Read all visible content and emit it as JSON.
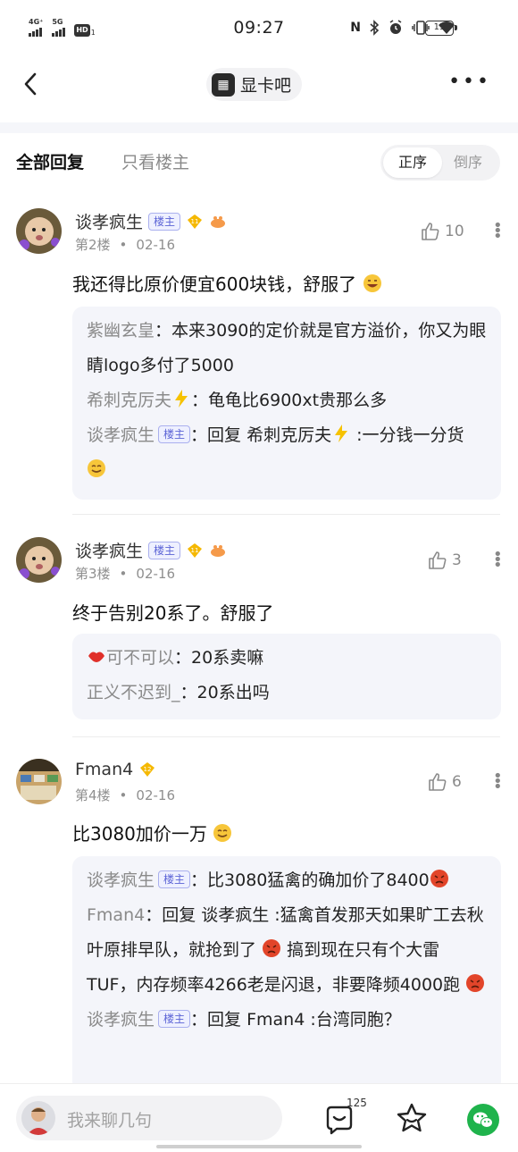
{
  "status_bar": {
    "time": "09:27",
    "sig1": "4G⁺",
    "sig2": "5G",
    "hd": "HD",
    "hd_sub": "1",
    "battery": "15"
  },
  "nav": {
    "forum_name": "显卡吧"
  },
  "sort": {
    "all_replies": "全部回复",
    "only_op": "只看楼主",
    "order_asc": "正序",
    "order_desc": "倒序"
  },
  "posts": [
    {
      "username": "谈孝疯生",
      "owner_badge": "楼主",
      "level": "11",
      "floor": "第2楼",
      "date": "02-16",
      "likes": "10",
      "content": "我还得比原价便宜600块钱，舒服了",
      "replies": [
        {
          "name": "紫幽玄皇",
          "text": "：本来3090的定价就是官方溢价，你又为眼睛logo多付了5000"
        },
        {
          "name": "希刺克厉夫",
          "text": "：龟龟比6900xt贵那么多"
        },
        {
          "name": "谈孝疯生",
          "badge": "楼主",
          "text": "：回复 希刺克厉夫",
          "text2": " :一分钱一分货"
        }
      ]
    },
    {
      "username": "谈孝疯生",
      "owner_badge": "楼主",
      "level": "11",
      "floor": "第3楼",
      "date": "02-16",
      "likes": "3",
      "content": "终于告别20系了。舒服了",
      "replies": [
        {
          "name": "可不可以",
          "text": "：20系卖嘛"
        },
        {
          "name": "正义不迟到_",
          "text": "：20系出吗"
        }
      ]
    },
    {
      "username": "Fman4",
      "level": "12",
      "floor": "第4楼",
      "date": "02-16",
      "likes": "6",
      "content": "比3080加价一万",
      "replies": [
        {
          "name": "谈孝疯生",
          "badge": "楼主",
          "text": "：比3080猛禽的确加价了8400"
        },
        {
          "name": "Fman4",
          "text": "：回复 谈孝疯生 :猛禽首发那天如果旷工去秋叶原排早队，就抢到了",
          "text2": " 搞到现在只有个大雷TUF，内存频率4266老是闪退，非要降频4000跑"
        },
        {
          "name": "谈孝疯生",
          "badge": "楼主",
          "text": "：回复 Fman4 :台湾同胞？"
        }
      ]
    }
  ],
  "bottom_bar": {
    "placeholder": "我来聊几句",
    "comment_count": "125"
  },
  "colors": {
    "accent": "#5b63d6",
    "wechat": "#1fb34c",
    "reply_bg": "#f4f5fa"
  }
}
